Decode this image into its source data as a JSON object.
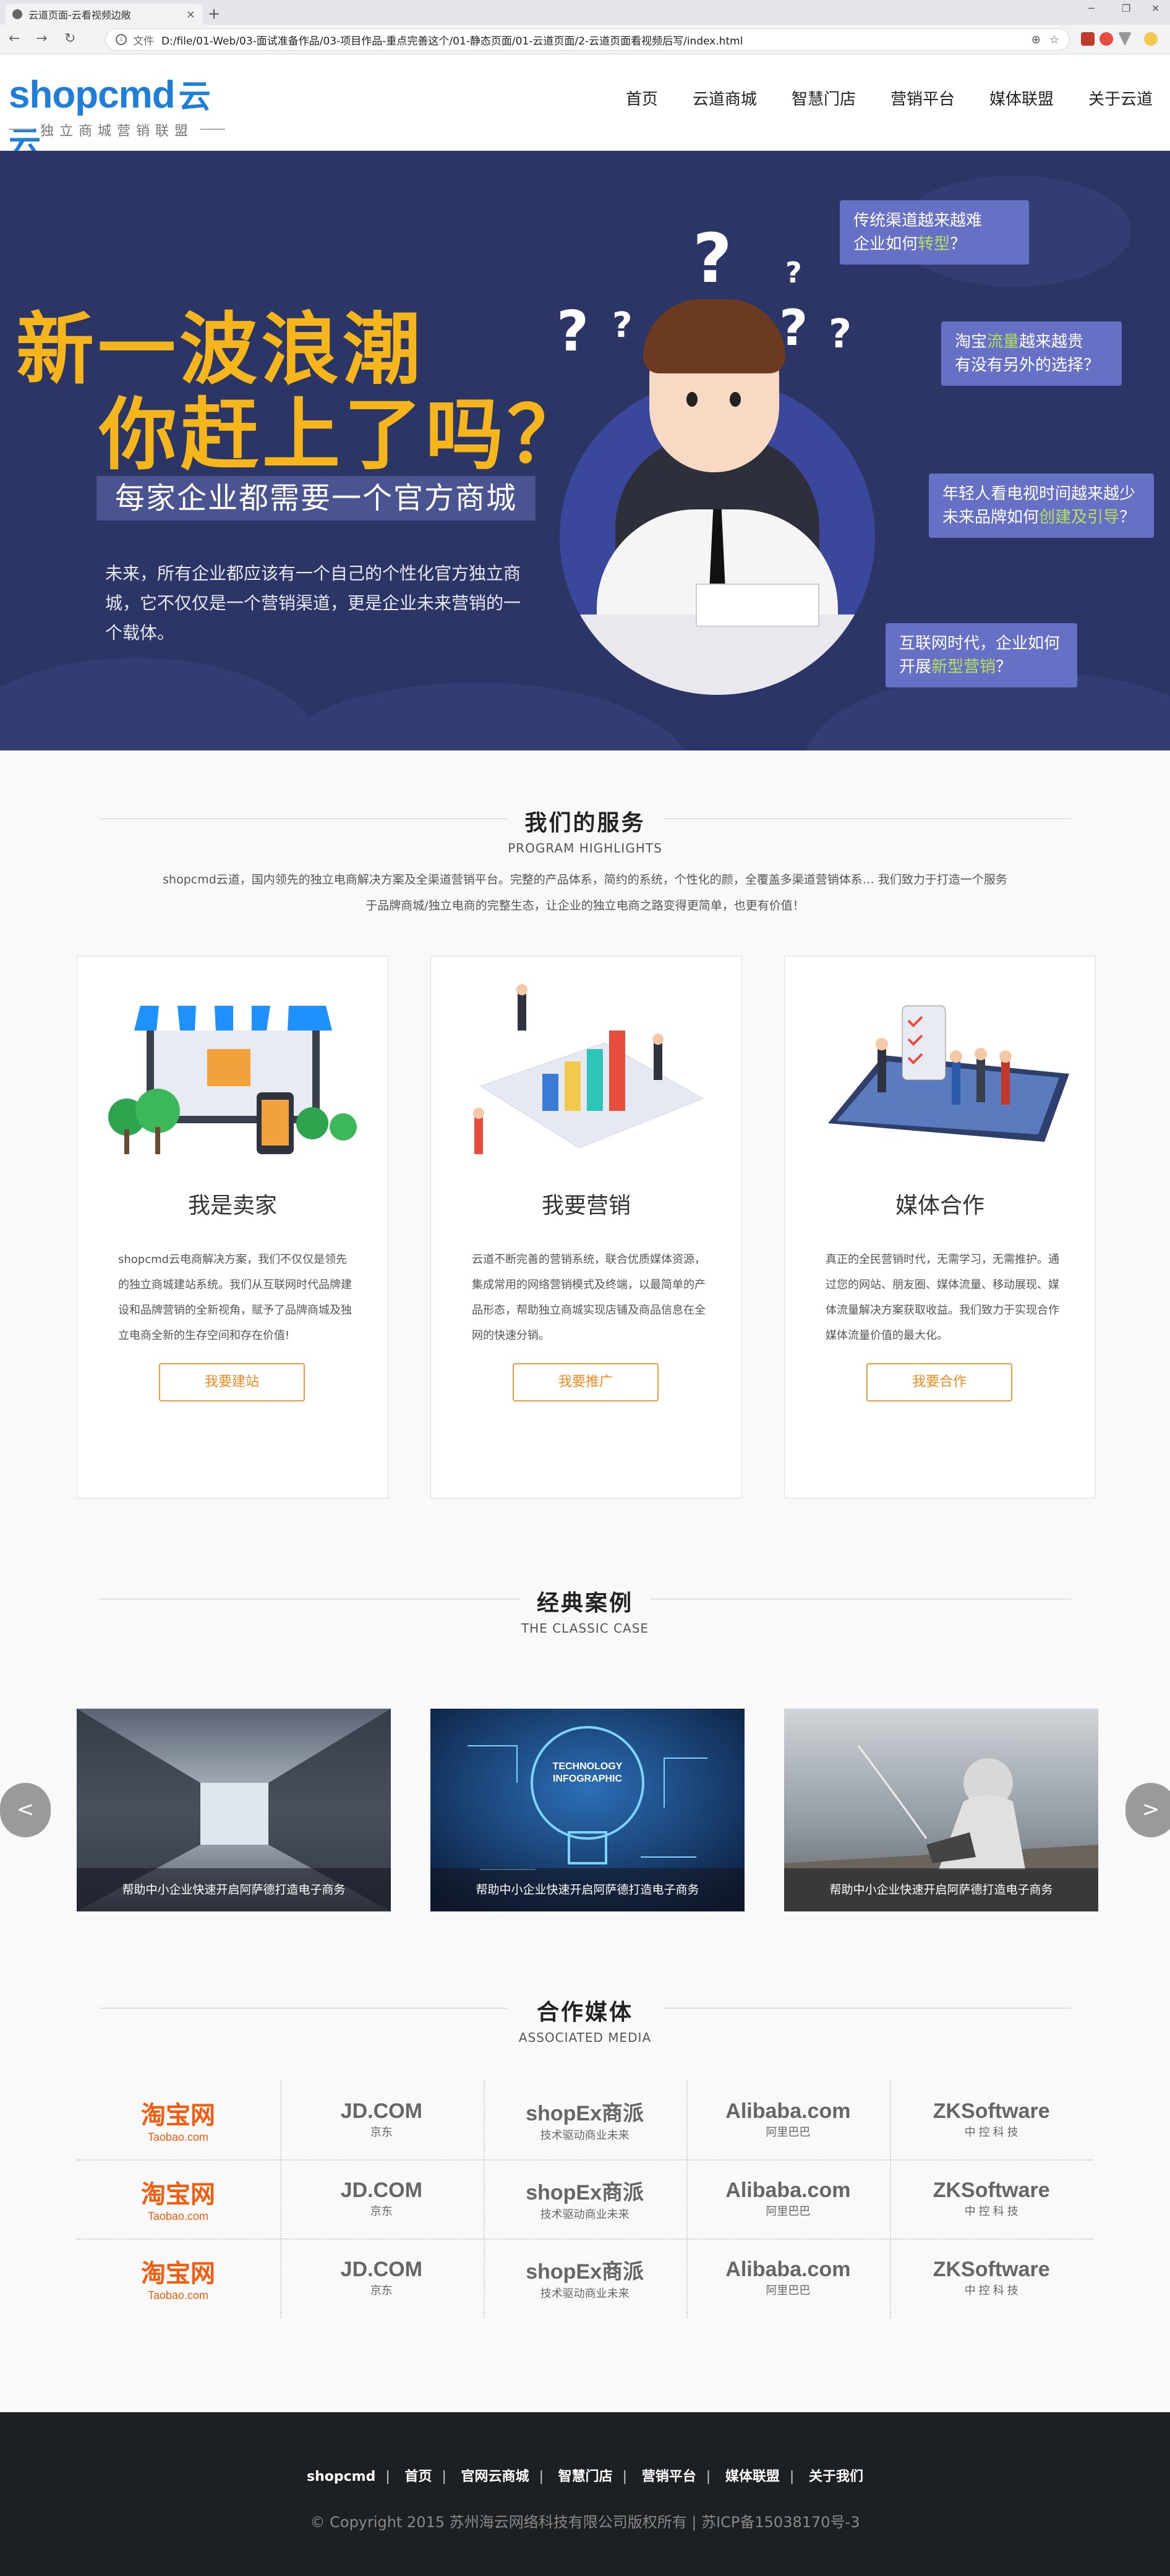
{
  "browser": {
    "tab_title": "云道页面-云看视频边敞",
    "tab_close": "×",
    "new_tab": "+",
    "address_scheme": "文件",
    "address_url": "D:/file/01-Web/03-面试准备作品/03-项目作品-重点完善这个/01-静态页面/01-云道页面/2-云道页面看视频后写/index.html",
    "win_min": "─",
    "win_max": "❐",
    "win_close": "✕",
    "back": "←",
    "forward": "→",
    "reload": "↻",
    "zoom_icon": "⊕",
    "star_icon": "☆"
  },
  "header": {
    "logo_text": "shopcmd",
    "logo_cn": "云云",
    "logo_sub": "独立商城营销联盟",
    "nav": [
      "首页",
      "云道商城",
      "智慧门店",
      "营销平台",
      "媒体联盟",
      "关于云道"
    ]
  },
  "hero": {
    "line1": "新一波浪潮",
    "line2": "你赶上了吗？",
    "tag": "每家企业都需要一个官方商城",
    "desc": "未来，所有企业都应该有一个自己的个性化官方独立商城，它不仅仅是一个营销渠道，更是企业未来营销的一个载体。",
    "bubbles": [
      {
        "pre": "传统渠道越来越难\n企业如何",
        "hl": "转型",
        "post": "？"
      },
      {
        "pre": "淘宝",
        "hl": "流量",
        "post": "越来越贵\n有没有另外的选择？"
      },
      {
        "pre": "年轻人看电视时间越来越少\n未来品牌如何",
        "hl": "创建及引导",
        "post": "？"
      },
      {
        "pre": "互联网时代，企业如何\n开展",
        "hl": "新型营销",
        "post": "？"
      }
    ],
    "accent": "#f7b51c",
    "bg": "#2b3566"
  },
  "services": {
    "title": "我们的服务",
    "subtitle": "PROGRAM HIGHLIGHTS",
    "intro": "shopcmd云道，国内领先的独立电商解决方案及全渠道营销平台。完整的产品体系，简约的系统，个性化的颜，全覆盖多渠道营销体系… 我们致力于打造一个服务于品牌商城/独立电商的完整生态，让企业的独立电商之路变得更简单，也更有价值！",
    "cards": [
      {
        "title": "我是卖家",
        "desc": "shopcmd云电商解决方案，我们不仅仅是领先的独立商城建站系统。我们从互联网时代品牌建设和品牌营销的全新视角，赋予了品牌商城及独立电商全新的生存空间和存在价值!",
        "button": "我要建站",
        "icon": "shop-icon"
      },
      {
        "title": "我要营销",
        "desc": "云道不断完善的营销系统，联合优质媒体资源，集成常用的网络营销模式及终端，以最简单的产品形态，帮助独立商城实现店铺及商品信息在全网的快速分销。",
        "button": "我要推广",
        "icon": "chart-icon"
      },
      {
        "title": "媒体合作",
        "desc": "真正的全民营销时代，无需学习，无需推护。通过您的网站、朋友圈、媒体流量、移动展现、媒体流量解决方案获取收益。我们致力于实现合作媒体流量价值的最大化。",
        "button": "我要合作",
        "icon": "media-icon"
      }
    ],
    "button_color": "#f59a3a"
  },
  "cases": {
    "title": "经典案例",
    "subtitle": "THE CLASSIC CASE",
    "items": [
      {
        "caption": "帮助中小企业快速开启阿萨德打造电子商务",
        "image": "server-room"
      },
      {
        "caption": "帮助中小企业快速开启阿萨德打造电子商务",
        "image": "technology-bulb"
      },
      {
        "caption": "帮助中小企业快速开启阿萨德打造电子商务",
        "image": "laptop-man"
      }
    ],
    "bulb_text": "TECHNOLOGY\nINFOGRAPHIC",
    "prev": "<",
    "next": ">"
  },
  "media": {
    "title": "合作媒体",
    "subtitle": "ASSOCIATED MEDIA",
    "logos": [
      {
        "main": "淘宝网",
        "sub": "Taobao.com",
        "color": "#f25d0f"
      },
      {
        "main": "JD.COM",
        "sub": "京东",
        "color": "#666666"
      },
      {
        "main": "shopEx商派",
        "sub": "技术驱动商业未来",
        "color": "#666666"
      },
      {
        "main": "Alibaba.com",
        "sub": "阿里巴巴",
        "color": "#666666"
      },
      {
        "main": "ZKSoftware",
        "sub": "中 控 科 技",
        "color": "#666666"
      }
    ]
  },
  "footer": {
    "links": [
      "shopcmd",
      "首页",
      "官网云商城",
      "智慧门店",
      "营销平台",
      "媒体联盟",
      "关于我们"
    ],
    "copyright": "© Copyright 2015 苏州海云网络科技有限公司版权所有 | 苏ICP备15038170号-3"
  }
}
